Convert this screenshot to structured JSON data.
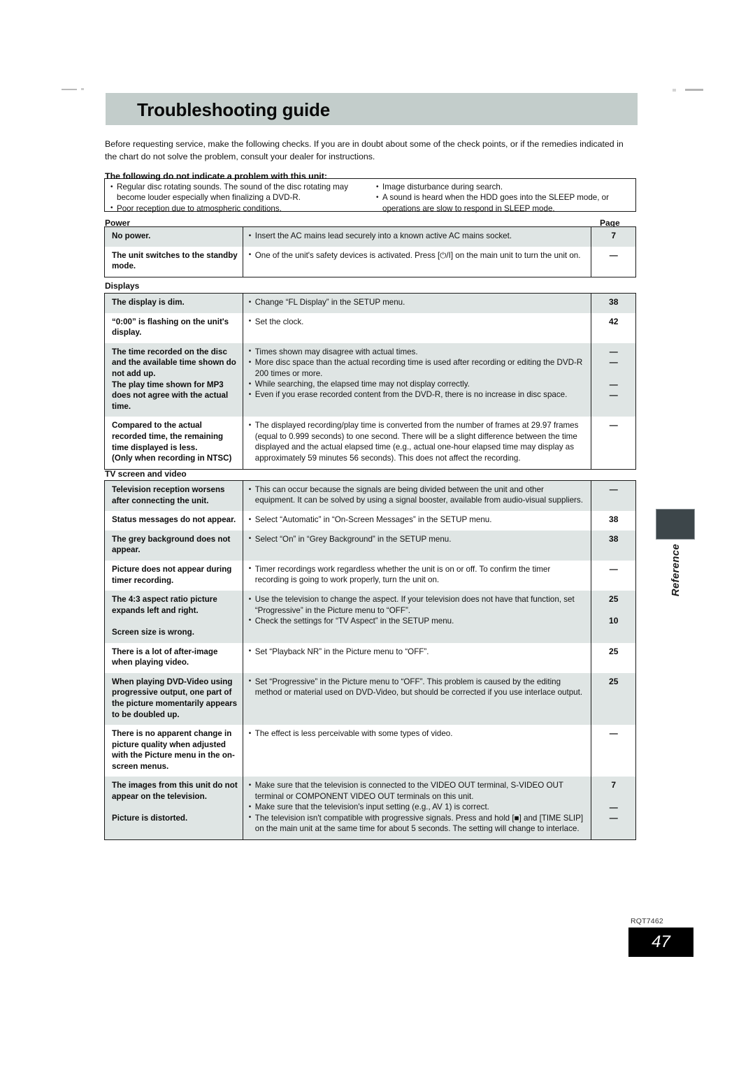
{
  "header": {
    "title": "Troubleshooting guide"
  },
  "intro": "Before requesting service, make the following checks. If you are in doubt about some of the check points, or if the remedies indicated in the chart do not solve the problem, consult your dealer for instructions.",
  "not_problem": {
    "heading": "The following do not indicate a problem with this unit:",
    "left_items": [
      "Regular disc rotating sounds. The sound of the disc rotating may become louder especially when finalizing a DVD-R.",
      "Poor reception due to atmospheric conditions."
    ],
    "right_items": [
      "Image disturbance during search.",
      "A sound is heard when the HDD goes into the SLEEP mode, or operations are slow to respond in SLEEP mode."
    ]
  },
  "column_headers": {
    "page": "Page"
  },
  "sections": [
    {
      "label": "Power",
      "rows": [
        {
          "symptom": [
            "No power."
          ],
          "remedies": [
            "Insert the AC mains lead securely into a known active AC mains socket."
          ],
          "pages": [
            "7"
          ]
        },
        {
          "symptom": [
            "The unit switches to the standby mode."
          ],
          "remedies": [
            "One of the unit's safety devices is activated. Press [⏻/I] on the main unit to turn the unit on."
          ],
          "pages": [
            "—"
          ]
        }
      ]
    },
    {
      "label": "Displays",
      "rows": [
        {
          "symptom": [
            "The display is dim."
          ],
          "remedies": [
            "Change “FL Display” in the SETUP menu."
          ],
          "pages": [
            "38"
          ]
        },
        {
          "symptom": [
            "“0:00” is flashing on the unit's display."
          ],
          "remedies": [
            "Set the clock."
          ],
          "pages": [
            "42"
          ]
        },
        {
          "symptom": [
            "The time recorded on the disc and the available time shown do not add up.",
            "The play time shown for MP3 does not agree with the actual time."
          ],
          "remedies": [
            "Times shown may disagree with actual times.",
            "More disc space than the actual recording time is used after recording or editing the DVD-R 200 times or more.",
            "While searching, the elapsed time may not display correctly.",
            "Even if you erase recorded content from the DVD-R, there is no increase in disc space."
          ],
          "pages": [
            "—",
            "—",
            "—",
            "—"
          ]
        },
        {
          "symptom": [
            "Compared to the actual recorded time, the remaining time displayed is less.",
            "(Only when recording in NTSC)"
          ],
          "remedies": [
            "The displayed recording/play time is converted from the number of frames at 29.97 frames (equal to 0.999 seconds) to one second. There will be a slight difference between the time displayed and the actual elapsed time (e.g., actual one-hour elapsed time may display as approximately 59 minutes 56 seconds). This does not affect the recording."
          ],
          "pages": [
            "—"
          ]
        }
      ]
    },
    {
      "label": "TV screen and video",
      "rows": [
        {
          "symptom": [
            "Television reception worsens after connecting the unit."
          ],
          "remedies": [
            "This can occur because the signals are being divided between the unit and other equipment. It can be solved by using a signal booster, available from audio-visual suppliers."
          ],
          "pages": [
            "—"
          ]
        },
        {
          "symptom": [
            "Status messages do not appear."
          ],
          "remedies": [
            "Select “Automatic” in “On-Screen Messages” in the SETUP menu."
          ],
          "pages": [
            "38"
          ]
        },
        {
          "symptom": [
            "The grey background does not appear."
          ],
          "remedies": [
            "Select “On” in “Grey Background” in the SETUP menu."
          ],
          "pages": [
            "38"
          ]
        },
        {
          "symptom": [
            "Picture does not appear during timer recording."
          ],
          "remedies": [
            "Timer recordings work regardless whether the unit is on or off. To confirm the timer recording is going to work properly, turn the unit on."
          ],
          "pages": [
            "—"
          ]
        },
        {
          "symptom": [
            "The 4:3 aspect ratio picture expands left and right.",
            "Screen size is wrong."
          ],
          "remedies": [
            "Use the television to change the aspect. If your television does not have that function, set “Progressive” in the Picture menu to “OFF”.",
            "Check the settings for “TV Aspect” in the SETUP menu."
          ],
          "pages": [
            "25",
            "10"
          ]
        },
        {
          "symptom": [
            "There is a lot of after-image when playing video."
          ],
          "remedies": [
            "Set “Playback NR” in the Picture menu to “OFF”."
          ],
          "pages": [
            "25"
          ]
        },
        {
          "symptom": [
            "When playing DVD-Video using progressive output, one part of the picture momentarily appears to be doubled up."
          ],
          "remedies": [
            "Set “Progressive” in the Picture menu to “OFF”. This problem is caused by the editing method or material used on DVD-Video, but should be corrected if you use interlace output."
          ],
          "pages": [
            "25"
          ]
        },
        {
          "symptom": [
            "There is no apparent change in picture quality when adjusted with the Picture menu in the on-screen menus."
          ],
          "remedies": [
            "The effect is less perceivable with some types of video."
          ],
          "pages": [
            "—"
          ]
        },
        {
          "symptom": [
            "The images from this unit do not appear on the television.",
            "Picture is distorted."
          ],
          "remedies": [
            "Make sure that the television is connected to the VIDEO OUT terminal, S-VIDEO OUT terminal or COMPONENT VIDEO OUT terminals on this unit.",
            "Make sure that the television's input setting (e.g., AV 1) is correct.",
            "The television isn't compatible with progressive signals. Press and hold [■] and [TIME SLIP] on the main unit at the same time for about 5 seconds. The setting will change to interlace."
          ],
          "pages": [
            "7",
            "—",
            "—"
          ]
        }
      ]
    }
  ],
  "margin_tab": {
    "label": "Reference"
  },
  "footer": {
    "doc_code": "RQT7462",
    "page_number": "47"
  },
  "colors": {
    "header_bar": "#c3cdcb",
    "row_shade": "#dfe5e4",
    "tab_block": "#3d464a",
    "page_box": "#000000"
  }
}
